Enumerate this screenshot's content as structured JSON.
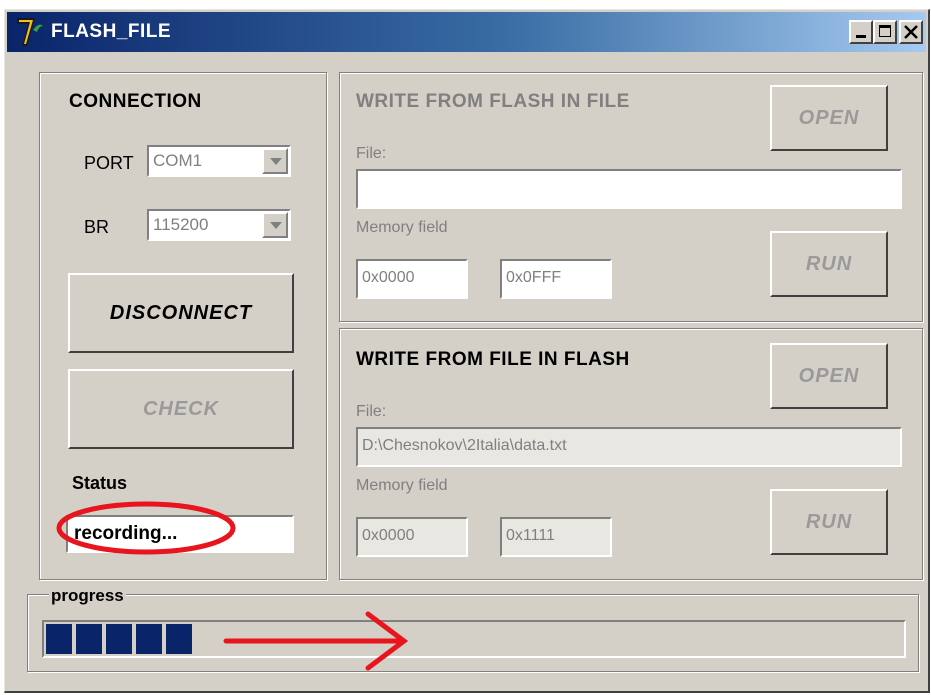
{
  "window": {
    "title": "FLASH_FILE",
    "controls": [
      "minimize",
      "maximize",
      "close"
    ]
  },
  "connection": {
    "heading": "CONNECTION",
    "port_label": "PORT",
    "port_value": "COM1",
    "br_label": "BR",
    "br_value": "115200",
    "disconnect_label": "DISCONNECT",
    "check_label": "CHECK",
    "status_label": "Status",
    "status_value": "recording..."
  },
  "write_flash_to_file": {
    "heading": "WRITE FROM FLASH IN FILE",
    "open_label": "OPEN",
    "file_label": "File:",
    "file_value": "",
    "memory_label": "Memory field",
    "mem_start": "0x0000",
    "mem_end": "0x0FFF",
    "run_label": "RUN"
  },
  "write_file_to_flash": {
    "heading": "WRITE FROM FILE IN FLASH",
    "open_label": "OPEN",
    "file_label": "File:",
    "file_value": "D:\\Chesnokov\\2Italia\\data.txt",
    "memory_label": "Memory field",
    "mem_start": "0x0000",
    "mem_end": "0x1111",
    "run_label": "RUN"
  },
  "progress": {
    "label": "progress",
    "filled_blocks": 5,
    "fraction": 0.17
  },
  "annotations": {
    "circle_color": "#e8141e",
    "arrow_color": "#e8141e"
  },
  "colors": {
    "title_gradient_start": "#0a246a",
    "title_gradient_end": "#a6caf0",
    "progress_fill": "#0a246a",
    "window_bg": "#d4d0c8"
  }
}
